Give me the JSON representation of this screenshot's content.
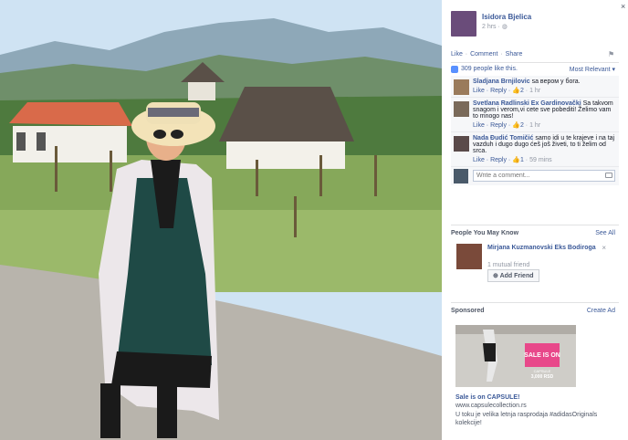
{
  "photo": {
    "alt": "photo"
  },
  "close": {
    "label": "×"
  },
  "post": {
    "author": "Isidora Bjelica",
    "time": "2 hrs",
    "privacy_icon": "globe-icon"
  },
  "actions": {
    "like": "Like",
    "comment": "Comment",
    "share": "Share"
  },
  "likes": {
    "count": "309",
    "suffix": "people like this.",
    "sort": "Most Relevant ▾"
  },
  "comments": [
    {
      "name": "Sladjana Brnjilovic",
      "text": "sa верoм у бога.",
      "like": "Like",
      "reply": "Reply",
      "likes": "2",
      "age": "1 hr"
    },
    {
      "name": "Svetlana Radlinski Ex Gardinovački",
      "text": "Sa takvom snagom i verom,vi cete sve pobediti! Želimo vam to mnogo nas!",
      "like": "Like",
      "reply": "Reply",
      "likes": "2",
      "age": "1 hr"
    },
    {
      "name": "Nada Đudić Tomičić",
      "text": "samo idi u te krajeve i na taj vazduh i dugo dugo ćeš još živeti, to ti želim od srca.",
      "like": "Like",
      "reply": "Reply",
      "likes": "1",
      "age": "59 mins"
    }
  ],
  "write_comment": {
    "placeholder": "Write a comment..."
  },
  "pymk": {
    "title": "People You May Know",
    "see_all": "See All",
    "person": {
      "name": "Mirjana Kuzmanovski Eks Bodiroga",
      "mutual": "1 mutual friend",
      "add": "Add Friend",
      "dismiss": "×"
    }
  },
  "sponsored": {
    "title": "Sponsored",
    "create_ad": "Create Ad",
    "ad_headline": "Sale is on CAPSULE!",
    "ad_url": "www.capsulecollection.rs",
    "ad_text": "U toku je velika letnja rasprodaja #adidasOriginals kolekcije!",
    "ad_badge": "SALE IS ON",
    "ad_badge_sub": "CAPSULE",
    "ad_badge_price": "3,000 RSD"
  },
  "colors": {
    "link": "#3b5998",
    "accent": "#5890ff",
    "muted": "#9197a3"
  }
}
